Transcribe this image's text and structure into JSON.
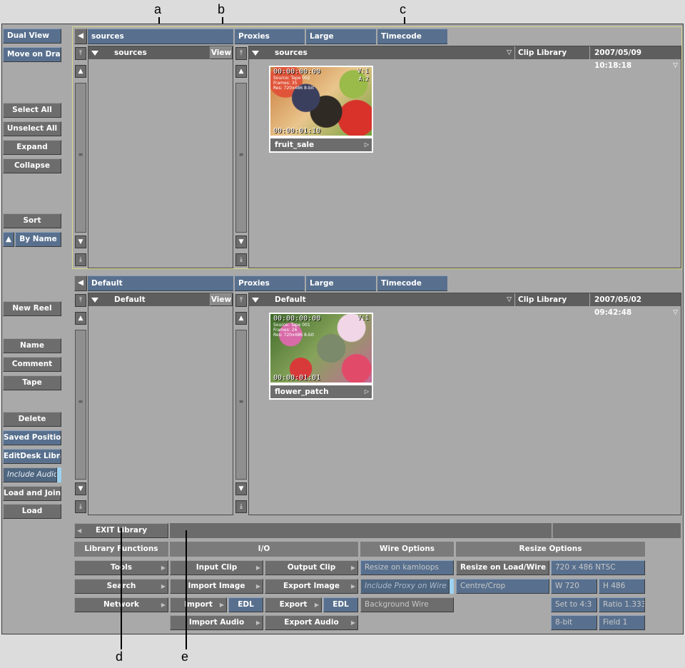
{
  "callouts": {
    "a": "a",
    "b": "b",
    "c": "c",
    "d": "d",
    "e": "e"
  },
  "left_menu": {
    "dual_view": "Dual View",
    "move_on_drag": "Move on Drag",
    "select_all": "Select All",
    "unselect_all": "Unselect All",
    "expand": "Expand",
    "collapse": "Collapse",
    "sort": "Sort",
    "by_name": "By Name",
    "new_reel": "New Reel",
    "name": "Name",
    "comment": "Comment",
    "tape": "Tape",
    "delete": "Delete",
    "saved_position": "Saved Position",
    "editdesk_library": "EditDesk Library",
    "include_audio": "Include Audio",
    "load_and_join": "Load and Join",
    "load": "Load"
  },
  "top": {
    "tabs": [
      "sources",
      "Proxies",
      "Large",
      "Timecode"
    ],
    "tree_header": "sources",
    "view": "View",
    "list_header": "sources",
    "library": "Clip Library",
    "date": "2007/05/09 10:18:18",
    "clip": {
      "name": "fruit_sale",
      "tc_in": "00:00:00:00",
      "tc_out": "00:00:01:10",
      "badge": "V:1",
      "badge2": "A:2",
      "meta1": "Source: Tape 002",
      "meta2": "Frames: 35",
      "meta3": "Res: 720x486 8-bit"
    }
  },
  "bottom": {
    "tabs": [
      "Default",
      "Proxies",
      "Large",
      "Timecode"
    ],
    "tree_header": "Default",
    "view": "View",
    "list_header": "Default",
    "library": "Clip Library",
    "date": "2007/05/02 09:42:48",
    "clip": {
      "name": "flower_patch",
      "tc_in": "00:00:00:00",
      "tc_out": "00:00:01:01",
      "badge": "V:1",
      "meta1": "Source: Tape 001",
      "meta2": "Frames: 26",
      "meta3": "Res: 720x486 8-bit"
    }
  },
  "menubar": {
    "exit_library": "EXIT Library",
    "library_functions": "Library Functions",
    "tools": "Tools",
    "search": "Search",
    "network": "Network",
    "io": "I/O",
    "input_clip": "Input Clip",
    "output_clip": "Output Clip",
    "import_image": "Import Image",
    "export_image": "Export Image",
    "import": "Import",
    "import_edl": "EDL",
    "export": "Export",
    "export_edl": "EDL",
    "import_audio": "Import Audio",
    "export_audio": "Export Audio",
    "wire_options": "Wire Options",
    "resize_on_kamloops": "Resize on kamloops",
    "include_proxy_on_wire": "Include Proxy on Wire",
    "background_wire": "Background Wire",
    "resize_options": "Resize Options",
    "resize_on_load_wire": "Resize on Load/Wire",
    "format": "720 x 486 NTSC",
    "centre_crop": "Centre/Crop",
    "width": "W 720",
    "height": "H 486",
    "set_to": "Set to 4:3",
    "ratio": "Ratio 1.333",
    "bit": "8-bit",
    "field": "Field 1"
  }
}
